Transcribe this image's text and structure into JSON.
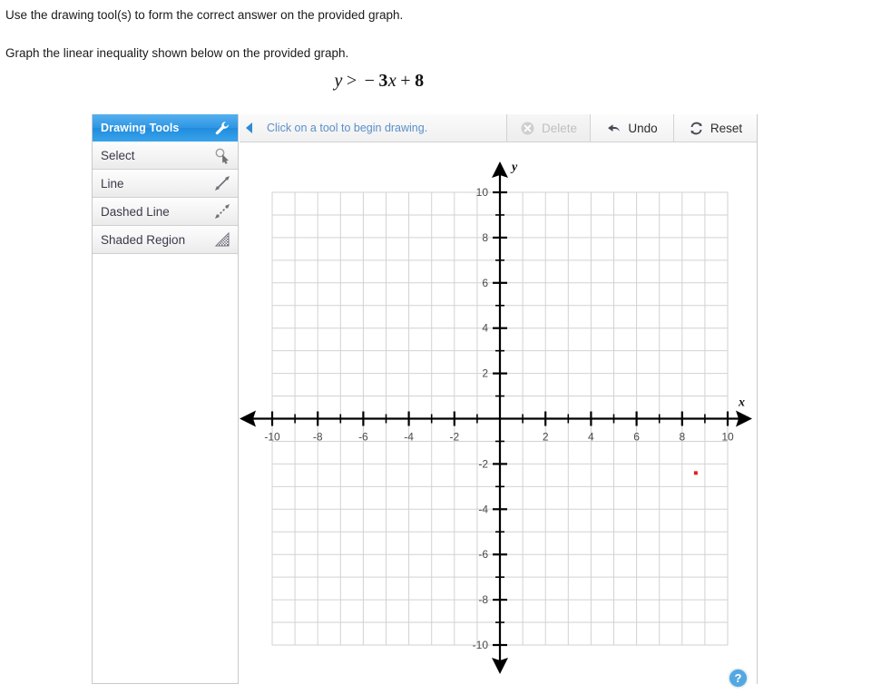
{
  "instructions": {
    "line1": "Use the drawing tool(s) to form the correct answer on the provided graph.",
    "line2": "Graph the linear inequality shown below on the provided graph."
  },
  "equation": {
    "lhs": "y",
    "relation": ">",
    "sign": "−",
    "coefficient": "3",
    "variable": "x",
    "plus": "+",
    "constant": "8",
    "full_text": "y > − 3x + 8"
  },
  "tools_panel": {
    "title": "Drawing Tools",
    "header_icon": "wrench-icon",
    "items": [
      {
        "label": "Select",
        "icon": "cursor-select-icon"
      },
      {
        "label": "Line",
        "icon": "solid-line-icon"
      },
      {
        "label": "Dashed Line",
        "icon": "dashed-line-icon"
      },
      {
        "label": "Shaded Region",
        "icon": "shaded-region-icon"
      }
    ]
  },
  "action_bar": {
    "collapse_icon": "left-triangle-icon",
    "hint": "Click on a tool to begin drawing.",
    "buttons": [
      {
        "label": "Delete",
        "icon": "circle-x-icon",
        "disabled": true
      },
      {
        "label": "Undo",
        "icon": "undo-arrow-icon",
        "disabled": false
      },
      {
        "label": "Reset",
        "icon": "reset-refresh-icon",
        "disabled": false
      }
    ]
  },
  "help": {
    "icon": "question-mark-help-icon",
    "label": "?"
  },
  "colors": {
    "header_blue": "#2e96e4",
    "hint_blue": "#5b8fc9",
    "grid_gray": "#d2d2d2",
    "axis_black": "#000000",
    "marker_red": "#e02020",
    "panel_border": "#c9c9c9"
  },
  "chart_data": {
    "type": "scatter",
    "title": "",
    "xlabel": "x",
    "ylabel": "y",
    "xlim": [
      -10,
      10
    ],
    "ylim": [
      -10,
      10
    ],
    "grid": true,
    "legend": "none",
    "x_major_step": 2,
    "x_minor_step": 1,
    "y_major_step": 2,
    "y_minor_step": 1,
    "x_tick_labels": [
      "-10",
      "-8",
      "-6",
      "-4",
      "-2",
      "2",
      "4",
      "6",
      "8",
      "10"
    ],
    "x_tick_values": [
      -10,
      -8,
      -6,
      -4,
      -2,
      2,
      4,
      6,
      8,
      10
    ],
    "y_tick_labels": [
      "10",
      "8",
      "6",
      "4",
      "2",
      "-2",
      "-4",
      "-6",
      "-8",
      "-10"
    ],
    "y_tick_values": [
      10,
      8,
      6,
      4,
      2,
      -2,
      -4,
      -6,
      -8,
      -10
    ],
    "origin_label_hidden": true,
    "points": [
      {
        "name": "cursor-marker",
        "x": 8.6,
        "y": -2.4,
        "color": "#e02020",
        "size": 4
      }
    ],
    "series": [],
    "annotations": []
  }
}
